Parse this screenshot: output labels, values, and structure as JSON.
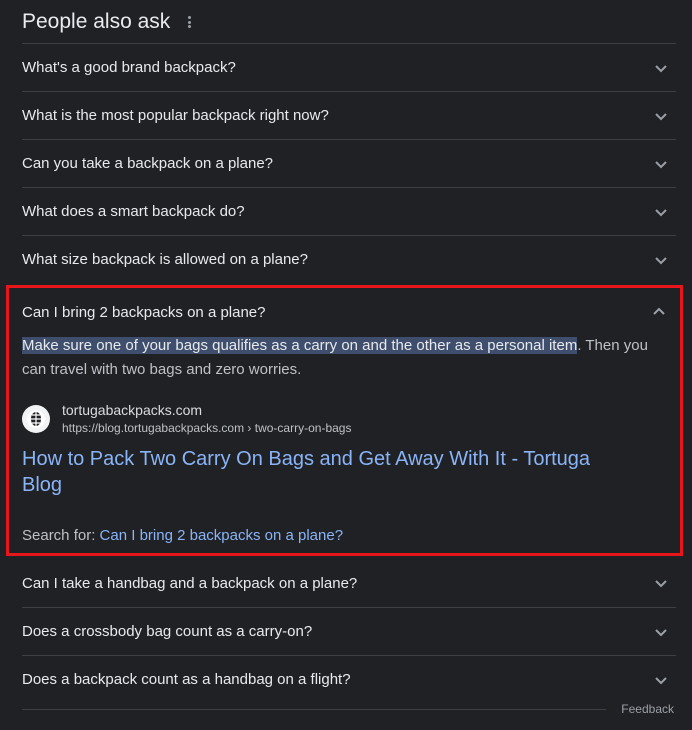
{
  "header": {
    "title": "People also ask"
  },
  "questions_top": [
    {
      "text": "What's a good brand backpack?"
    },
    {
      "text": "What is the most popular backpack right now?"
    },
    {
      "text": "Can you take a backpack on a plane?"
    },
    {
      "text": "What does a smart backpack do?"
    },
    {
      "text": "What size backpack is allowed on a plane?"
    }
  ],
  "expanded": {
    "question": "Can I bring 2 backpacks on a plane?",
    "answer_highlight": "Make sure one of your bags qualifies as a carry on and the other as a personal item",
    "answer_rest": ". Then you can travel with two bags and zero worries.",
    "source_name": "tortugabackpacks.com",
    "source_url": "https://blog.tortugabackpacks.com › two-carry-on-bags",
    "result_title": "How to Pack Two Carry On Bags and Get Away With It - Tortuga Blog",
    "search_for_label": "Search for: ",
    "search_for_link": "Can I bring 2 backpacks on a plane?"
  },
  "questions_bottom": [
    {
      "text": "Can I take a handbag and a backpack on a plane?"
    },
    {
      "text": "Does a crossbody bag count as a carry-on?"
    },
    {
      "text": "Does a backpack count as a handbag on a flight?"
    }
  ],
  "footer": {
    "feedback": "Feedback"
  },
  "colors": {
    "background": "#202124",
    "link": "#8ab4f8",
    "highlight_border": "#e8151b"
  }
}
